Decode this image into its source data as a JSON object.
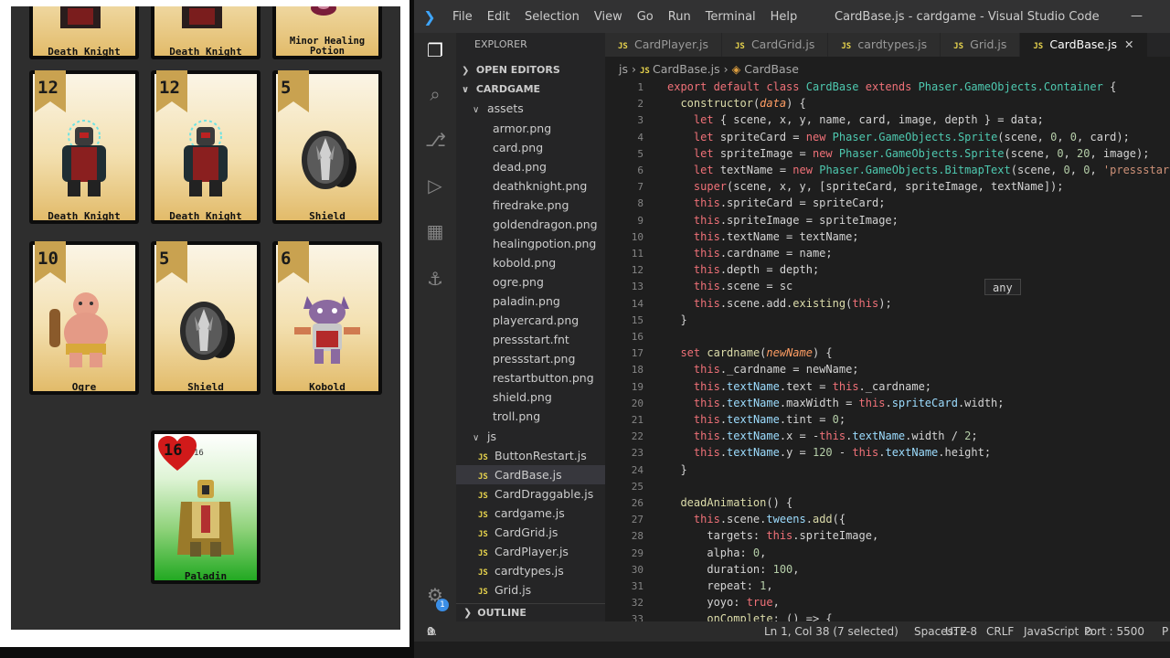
{
  "game": {
    "top_row": [
      {
        "name": "Death Knight"
      },
      {
        "name": "Death Knight"
      },
      {
        "name": "Minor Healing Potion"
      }
    ],
    "cards": [
      {
        "value": "12",
        "name": "Death Knight",
        "art": "death-knight"
      },
      {
        "value": "12",
        "name": "Death Knight",
        "art": "death-knight"
      },
      {
        "value": "5",
        "name": "Shield",
        "art": "shield"
      },
      {
        "value": "10",
        "name": "Ogre",
        "art": "ogre"
      },
      {
        "value": "5",
        "name": "Shield",
        "art": "shield"
      },
      {
        "value": "6",
        "name": "Kobold",
        "art": "kobold"
      }
    ],
    "player": {
      "health": "16",
      "small_health": "16",
      "name": "Paladin",
      "art": "paladin"
    }
  },
  "vscode": {
    "menu": [
      "File",
      "Edit",
      "Selection",
      "View",
      "Go",
      "Run",
      "Terminal",
      "Help"
    ],
    "window_title": "CardBase.js - cardgame - Visual Studio Code",
    "explorer_title": "EXPLORER",
    "open_editors": "OPEN EDITORS",
    "project": "CARDGAME",
    "assets_folder": "assets",
    "asset_files": [
      "armor.png",
      "card.png",
      "dead.png",
      "deathknight.png",
      "firedrake.png",
      "goldendragon.png",
      "healingpotion.png",
      "kobold.png",
      "ogre.png",
      "paladin.png",
      "playercard.png",
      "pressstart.fnt",
      "pressstart.png",
      "restartbutton.png",
      "shield.png",
      "troll.png"
    ],
    "js_folder": "js",
    "js_files": [
      "ButtonRestart.js",
      "CardBase.js",
      "CardDraggable.js",
      "cardgame.js",
      "CardGrid.js",
      "CardPlayer.js",
      "cardtypes.js",
      "Grid.js"
    ],
    "outline": "OUTLINE",
    "tabs": [
      "CardPlayer.js",
      "CardGrid.js",
      "cardtypes.js",
      "Grid.js",
      "CardBase.js"
    ],
    "breadcrumb": {
      "folder": "js",
      "file": "CardBase.js",
      "symbol": "CardBase"
    },
    "hover": "any",
    "status": {
      "errors": "0",
      "warnings": "0",
      "position": "Ln 1, Col 38 (7 selected)",
      "spaces": "Spaces: 2",
      "encoding": "UTF-8",
      "eol": "CRLF",
      "language": "JavaScript",
      "port": "Port : 5500",
      "extra": "P"
    },
    "badge": "1",
    "colors": {
      "accent": "#3a8ee6",
      "keyword": "#f07178",
      "class": "#4ec9b0",
      "function": "#dcdcaa",
      "string": "#ce9178",
      "number": "#b5cea8"
    }
  }
}
